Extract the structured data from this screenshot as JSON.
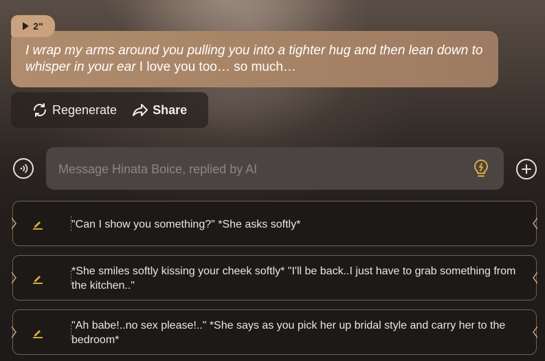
{
  "message": {
    "voice_duration": "2\"",
    "action_text": "I wrap my arms around you pulling you into a tighter hug and then lean down to whisper in your ear",
    "speech_text": " I love you too… so much…"
  },
  "actions": {
    "regenerate_label": "Regenerate",
    "share_label": "Share"
  },
  "composer": {
    "placeholder": "Message Hinata Boice, replied by AI"
  },
  "suggestions": [
    {
      "text": "\"Can I show you something?\" *She asks softly*"
    },
    {
      "text": "*She smiles softly kissing your cheek softly* \"I'll be back..I just have to grab something from the kitchen..\""
    },
    {
      "text": "\"Ah babe!..no sex please!..\" *She says as you pick her up bridal style and carry her to the bedroom*"
    }
  ],
  "colors": {
    "bubble": "#a88467",
    "accent_gold": "#d8aa3e",
    "suggestion_border": "#6e6253"
  }
}
